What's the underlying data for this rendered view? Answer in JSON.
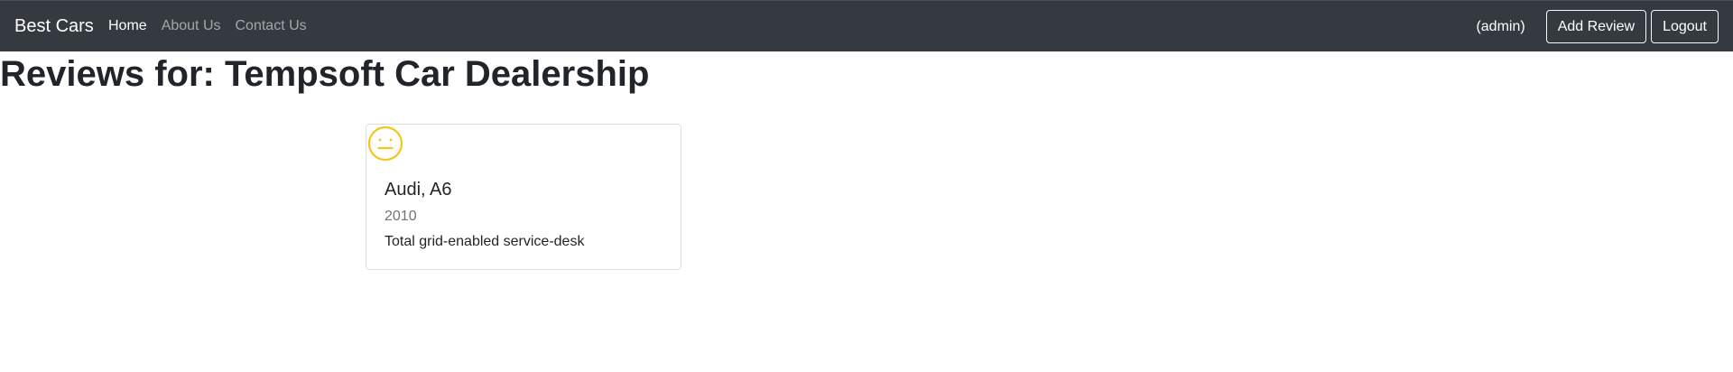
{
  "navbar": {
    "brand": "Best Cars",
    "links": [
      {
        "label": "Home",
        "active": true
      },
      {
        "label": "About Us",
        "active": false
      },
      {
        "label": "Contact Us",
        "active": false
      }
    ],
    "user": "(admin)",
    "add_review_label": "Add Review",
    "logout_label": "Logout"
  },
  "page": {
    "title": "Reviews for: Tempsoft Car Dealership"
  },
  "reviews": [
    {
      "sentiment_icon": "neutral-face-icon",
      "sentiment_color": "#f5c518",
      "car": "Audi, A6",
      "year": "2010",
      "review": "Total grid-enabled service-desk"
    }
  ],
  "colors": {
    "navbar_bg": "#343a40",
    "text": "#212529",
    "muted": "#6c757d"
  }
}
